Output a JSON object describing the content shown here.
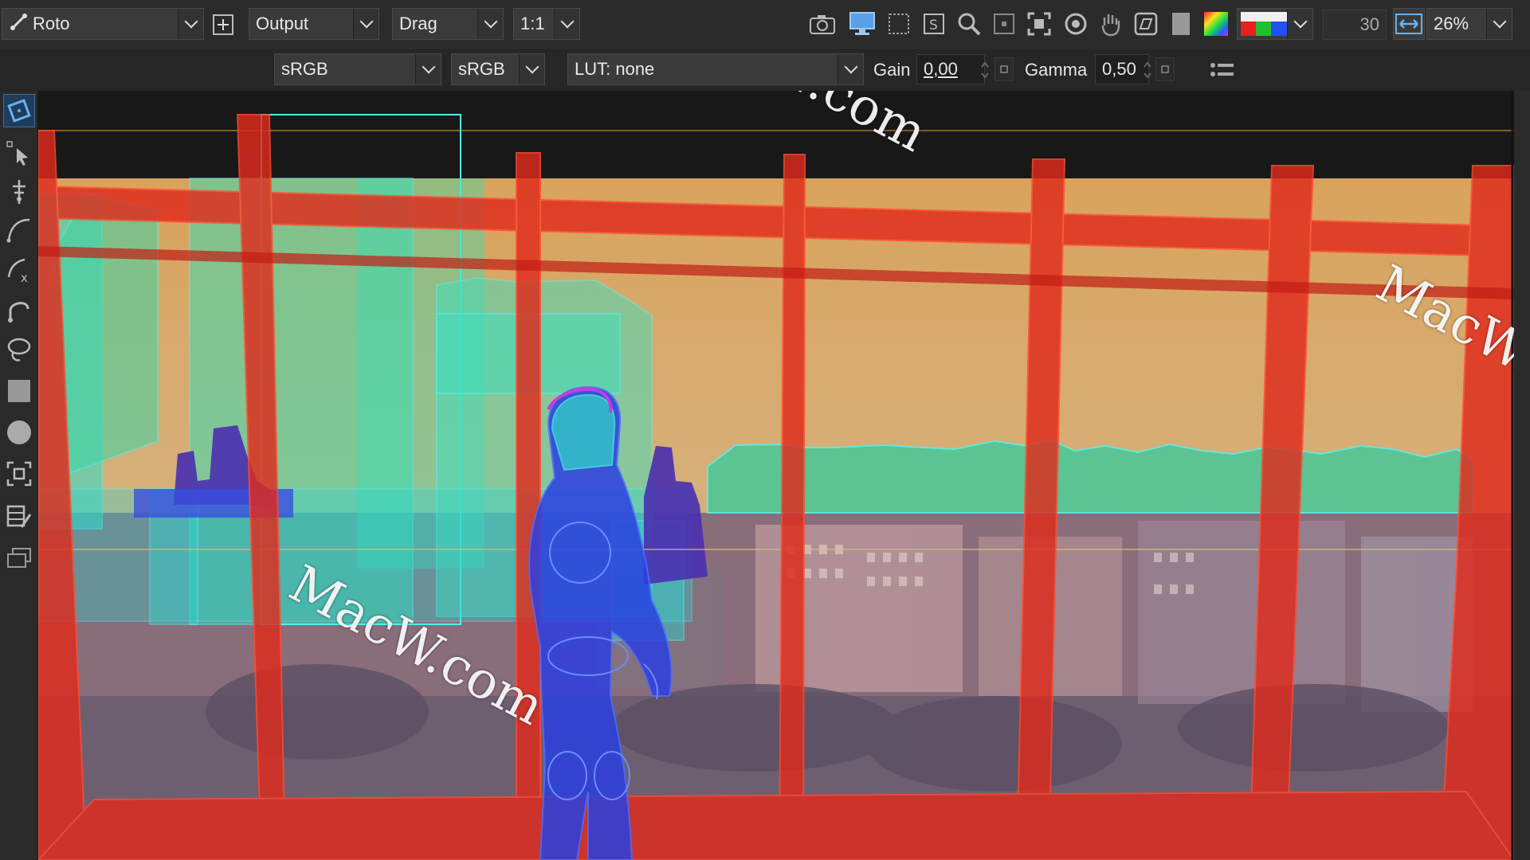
{
  "toolbar": {
    "mode_dropdown": "Roto",
    "output_dropdown": "Output",
    "drag_dropdown": "Drag",
    "zoom_ratio_dropdown": "1:1",
    "frame_value": "30",
    "zoom_percent": "26%"
  },
  "display": {
    "input_colorspace": "sRGB",
    "output_colorspace": "sRGB",
    "lut": "LUT: none",
    "gain_label": "Gain",
    "gain_value": "0,00",
    "gamma_label": "Gamma",
    "gamma_value": "0,50"
  },
  "watermarks": [
    "MacW.com",
    "MacW.com",
    "MacW.c"
  ],
  "colors": {
    "matte_red": "#e02a1c",
    "matte_cyan": "#2de0d0",
    "matte_blue": "#2b3fe0",
    "matte_purple": "#4a2fb0",
    "sky": "#d9a35c"
  },
  "icons": {
    "camera": "camera-icon",
    "monitor": "monitor-icon",
    "region": "region-icon",
    "safe": "safe-area-icon",
    "zoom": "magnifier-icon",
    "proxy": "proxy-icon",
    "fit": "fit-icon",
    "eye": "eye-icon",
    "hand": "hand-icon",
    "mask": "mask-icon",
    "color_wheel": "color-wheel-icon",
    "fit_width": "fit-width-icon",
    "menu": "list-menu-icon"
  }
}
